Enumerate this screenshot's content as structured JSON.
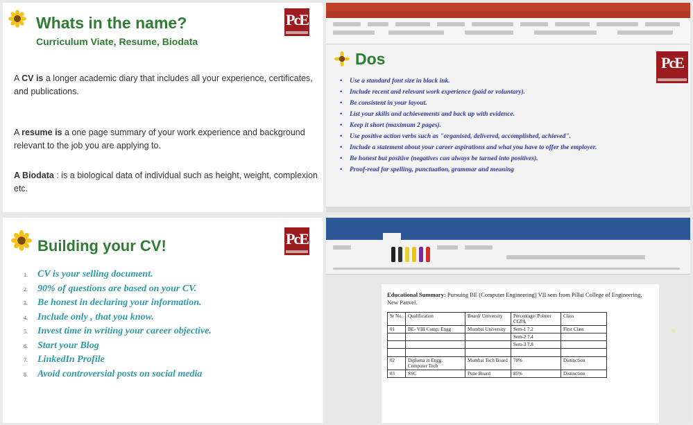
{
  "slide1": {
    "title": "Whats in the name?",
    "subtitle": "Curriculum Viate, Resume, Biodata",
    "cv_lead": "A ",
    "cv_term": "CV is",
    "cv_text": " a longer academic diary that includes all your experience, certificates, and publications.",
    "resume_lead": "A ",
    "resume_term": "resume is",
    "resume_text": " a one page summary of your work experience and background relevant to the job you are applying to.",
    "biodata_term": "A Biodata",
    "biodata_text": " : is a biological data of individual such as height, weight, complexion etc."
  },
  "slide_dos": {
    "title": "Dos",
    "items": [
      "Use a standard font size in black ink.",
      "Include recent and relevant work experience (paid or voluntary).",
      "Be consistent in your layout.",
      "List your skills and achievements and back up with evidence.",
      "Keep it short (maximum 2 pages).",
      "Use positive action verbs such as \"organised, delivered, accomplished, achieved\".",
      "Include a statement about your career aspirations and what you have to offer the employer.",
      "Be honest but positive (negatives can always be turned into positives).",
      "Proof-read for spelling, punctuation, grammar and meaning"
    ]
  },
  "slide3": {
    "title": "Building your CV!",
    "items": [
      {
        "num": "1.",
        "text": "CV is your selling document."
      },
      {
        "num": "2.",
        "text": "90% of questions are based on your CV."
      },
      {
        "num": "3.",
        "text": "Be honest in declaring your information."
      },
      {
        "num": "4.",
        "text": "Include only , that you know."
      },
      {
        "num": "5.",
        "text": "Invest time in writing your career objective."
      },
      {
        "num": "6.",
        "text": "Start your Blog"
      },
      {
        "num": "7.",
        "text": "LinkedIn Profile"
      },
      {
        "num": "8.",
        "text": "Avoid controversial posts on social media"
      }
    ]
  },
  "word_doc": {
    "edu_label": "Educational Summary:",
    "edu_text": " Pursuing BE (Computer Engineering) VII sem from Pillai College of Engineering, New Panvel.",
    "table_headers": [
      "Sr No.",
      "Qualification",
      "Board/ University",
      "Percentage/ Pointer CGPA",
      "Class"
    ],
    "table_rows": [
      [
        "01",
        "BE- VIII Comp. Engg",
        "Mumbai University",
        "Sem-1 7.2",
        "First Class"
      ],
      [
        "",
        "",
        "",
        "Sem-2 7.4",
        ""
      ],
      [
        "",
        "",
        "",
        "Sem-3 7.8",
        ""
      ],
      [
        "",
        "",
        "",
        "",
        ""
      ],
      [
        "02",
        "Diploma in Engg. Computer Tech",
        "Mumbai Tech Board",
        "78%",
        "Distinction"
      ],
      [
        "03",
        "SSC",
        "Pune Board",
        "85%",
        "Distinction"
      ]
    ]
  },
  "logo_text": "PcE",
  "colors": {
    "green_title": "#2e7d32",
    "teal_list": "#2f9ba6",
    "blue_list": "#2b3aa0",
    "logo_red": "#9b1b1f",
    "word_blue": "#2b5797",
    "ppt_red": "#c0412a"
  }
}
